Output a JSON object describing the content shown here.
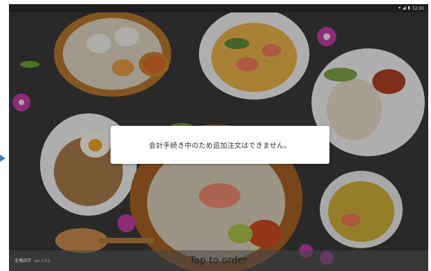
{
  "status_bar": {
    "time": "12:30",
    "wifi_icon": "wifi-icon",
    "signal_icon": "signal-icon",
    "battery_icon": "battery-icon"
  },
  "toast": {
    "message": "会計手続き中のため追加注文はできません。"
  },
  "footer": {
    "store_name": "全角四字",
    "version": "ver 2.5.0",
    "tap_label": "Tap to order"
  },
  "colors": {
    "toast_bg": "#ffffff",
    "bar_bg": "#464646",
    "arrow": "#3b7bbf"
  }
}
